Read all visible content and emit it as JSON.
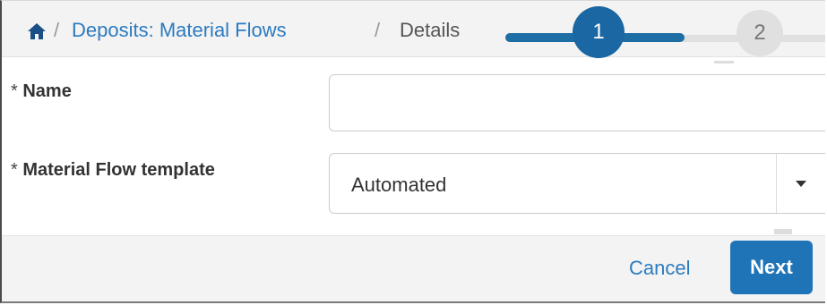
{
  "breadcrumb": {
    "home_icon": "home-icon",
    "separator": "/",
    "items": [
      "Deposits: Material Flows",
      "Details"
    ]
  },
  "stepper": {
    "steps": [
      "1",
      "2"
    ],
    "current": 1,
    "active_color": "#1a67a3",
    "inactive_color": "#e0e0e0"
  },
  "form": {
    "name": {
      "required_mark": "*",
      "label": "Name",
      "value": ""
    },
    "template": {
      "required_mark": "*",
      "label": "Material Flow template",
      "value": "Automated"
    }
  },
  "footer": {
    "cancel_label": "Cancel",
    "next_label": "Next",
    "primary_color": "#1f74b7"
  }
}
